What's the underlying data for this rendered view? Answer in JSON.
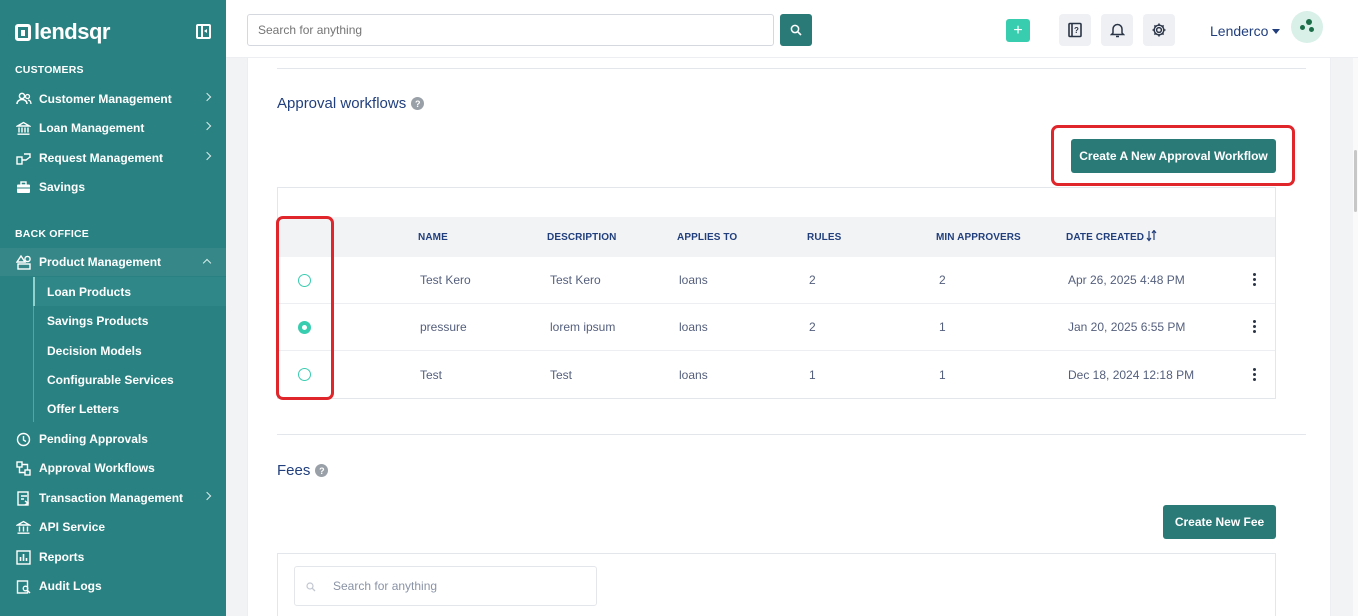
{
  "sidebar": {
    "brand": "lendsqr",
    "sections": {
      "customers": "CUSTOMERS",
      "back_office": "BACK OFFICE"
    },
    "items": {
      "customer_management": "Customer Management",
      "loan_management": "Loan Management",
      "request_management": "Request Management",
      "savings": "Savings",
      "product_management": "Product Management",
      "pending_approvals": "Pending Approvals",
      "approval_workflows": "Approval Workflows",
      "transaction_management": "Transaction Management",
      "api_service": "API Service",
      "reports": "Reports",
      "audit_logs": "Audit Logs"
    },
    "product_sub_items": [
      "Loan Products",
      "Savings Products",
      "Decision Models",
      "Configurable Services",
      "Offer Letters"
    ],
    "active_sub_item": "Loan Products"
  },
  "topbar": {
    "search_placeholder": "Search for anything",
    "plus_label": "+",
    "user_name": "Lenderco"
  },
  "approval": {
    "heading": "Approval workflows",
    "help": "?",
    "create_button": "Create A New Approval Workflow",
    "columns": [
      "NAME",
      "DESCRIPTION",
      "APPLIES TO",
      "RULES",
      "MIN APPROVERS",
      "DATE CREATED"
    ],
    "rows": [
      {
        "name": "Test Kero",
        "description": "Test Kero",
        "applies_to": "loans",
        "rules": "2",
        "min_approvers": "2",
        "date_created": "Apr 26, 2025 4:48 PM",
        "selected": false
      },
      {
        "name": "pressure",
        "description": "lorem ipsum",
        "applies_to": "loans",
        "rules": "2",
        "min_approvers": "1",
        "date_created": "Jan 20, 2025 6:55 PM",
        "selected": true
      },
      {
        "name": "Test",
        "description": "Test",
        "applies_to": "loans",
        "rules": "1",
        "min_approvers": "1",
        "date_created": "Dec 18, 2024 12:18 PM",
        "selected": false
      }
    ]
  },
  "fees": {
    "heading": "Fees",
    "help": "?",
    "create_button": "Create New Fee",
    "search_placeholder": "Search for anything"
  },
  "colors": {
    "sidebar_bg": "#2a8181",
    "primary": "#2a7a78",
    "accent": "#39cdb0",
    "highlight": "#e0262b"
  }
}
